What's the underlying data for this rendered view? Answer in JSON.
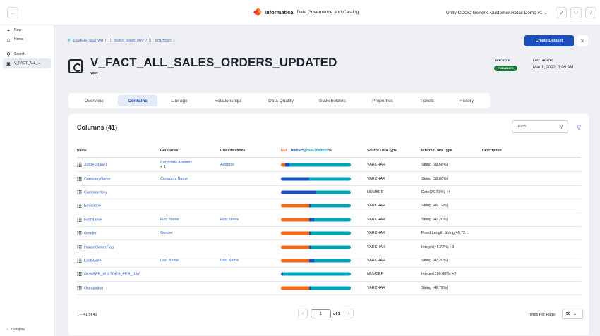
{
  "topbar": {
    "app_switch_icon": "grid-icon",
    "brand_name": "Informatica",
    "product": "Data Governance and Catalog",
    "org": "Unity CDGC Generic Customer Retail Demo v1",
    "org_chevron": "⌄",
    "icons": [
      "pin-icon",
      "user-icon",
      "help-icon"
    ]
  },
  "nav": {
    "new": "New",
    "home": "Home",
    "search": "Search",
    "active": "V_FACT_ALL_...",
    "collapse": "Collapse"
  },
  "breadcrumb": {
    "items": [
      "snowflake_retail_WH",
      "EMEA_DEMO_ENV",
      "CONTOSO"
    ]
  },
  "actions": {
    "create_dataset": "Create Dataset",
    "close": "×"
  },
  "asset": {
    "title": "V_FACT_ALL_SALES_ORDERS_UPDATED",
    "type": "VIEW",
    "lifecycle_label": "LIFECYCLE",
    "lifecycle_value": "PUBLISHED",
    "updated_label": "LAST UPDATED",
    "updated_value": "Mar 1, 2022, 3:09 AM"
  },
  "tabs": [
    "Overview",
    "Contains",
    "Lineage",
    "Relationships",
    "Data Quality",
    "Stakeholders",
    "Properties",
    "Tickets",
    "History"
  ],
  "active_tab": "Contains",
  "columns": {
    "title": "Columns (41)",
    "find_placeholder": "Find",
    "headers": {
      "name": "Name",
      "glossaries": "Glossaries",
      "classifications": "Classifications",
      "null": "Null",
      "sep1": " | ",
      "distinct": "Distinct",
      "sep2": " | ",
      "nondistinct": "Non-Distinct",
      "pct": " %",
      "source_type": "Source Data Type",
      "inferred_type": "Inferred Data Type",
      "description": "Description"
    },
    "colors": {
      "null": "#f26a1b",
      "distinct": "#1a4fbf",
      "nondistinct": "#00a6b8"
    },
    "rows": [
      {
        "name": "AddressLine1",
        "glossary": "Corporate Address",
        "glossary_extra": "+ 1",
        "classification": "Address",
        "bar": [
          6,
          6,
          88
        ],
        "source": "VARCHAR",
        "inferred": "String (99.68%)"
      },
      {
        "name": "CompanyName",
        "glossary": "Company Name",
        "glossary_extra": "",
        "classification": "",
        "bar": [
          0,
          40,
          60
        ],
        "source": "VARCHAR",
        "inferred": "String (52.80%)"
      },
      {
        "name": "CustomerKey",
        "glossary": "",
        "glossary_extra": "",
        "classification": "",
        "bar": [
          0,
          50,
          50
        ],
        "source": "NUMBER",
        "inferred": "Date(26.71%) +4"
      },
      {
        "name": "Education",
        "glossary": "",
        "glossary_extra": "",
        "classification": "",
        "bar": [
          40,
          2,
          58
        ],
        "source": "VARCHAR",
        "inferred": "String (46.72%)"
      },
      {
        "name": "FirstName",
        "glossary": "First Name",
        "glossary_extra": "",
        "classification": "First Name",
        "bar": [
          40,
          7,
          53
        ],
        "source": "VARCHAR",
        "inferred": "String (47.20%)"
      },
      {
        "name": "Gender",
        "glossary": "Gender",
        "glossary_extra": "",
        "classification": "",
        "bar": [
          40,
          2,
          58
        ],
        "source": "VARCHAR",
        "inferred": "Fixed Length String(46.72..."
      },
      {
        "name": "HouseOwnerFlag",
        "glossary": "",
        "glossary_extra": "",
        "classification": "",
        "bar": [
          40,
          2,
          58
        ],
        "source": "VARCHAR",
        "inferred": "Integer(46.72%) +3"
      },
      {
        "name": "LastName",
        "glossary": "Last Name",
        "glossary_extra": "",
        "classification": "Last Name",
        "bar": [
          40,
          7,
          53
        ],
        "source": "VARCHAR",
        "inferred": "String (47.20%)"
      },
      {
        "name": "NUMBER_VISITORS_PER_DAY",
        "glossary": "",
        "glossary_extra": "",
        "classification": "",
        "bar": [
          0,
          3,
          97
        ],
        "source": "NUMBER",
        "inferred": "Integer(100.00%) +2"
      },
      {
        "name": "Occupation",
        "glossary": "",
        "glossary_extra": "",
        "classification": "",
        "bar": [
          40,
          2,
          58
        ],
        "source": "VARCHAR",
        "inferred": "String (46.72%)"
      }
    ]
  },
  "pagination": {
    "range": "1 – 41 of 41",
    "prev": "‹",
    "next": "›",
    "page": "1",
    "of": "of 1",
    "items_per_page_label": "Items Per Page:",
    "items_per_page": "50",
    "chevron": "⌄"
  }
}
